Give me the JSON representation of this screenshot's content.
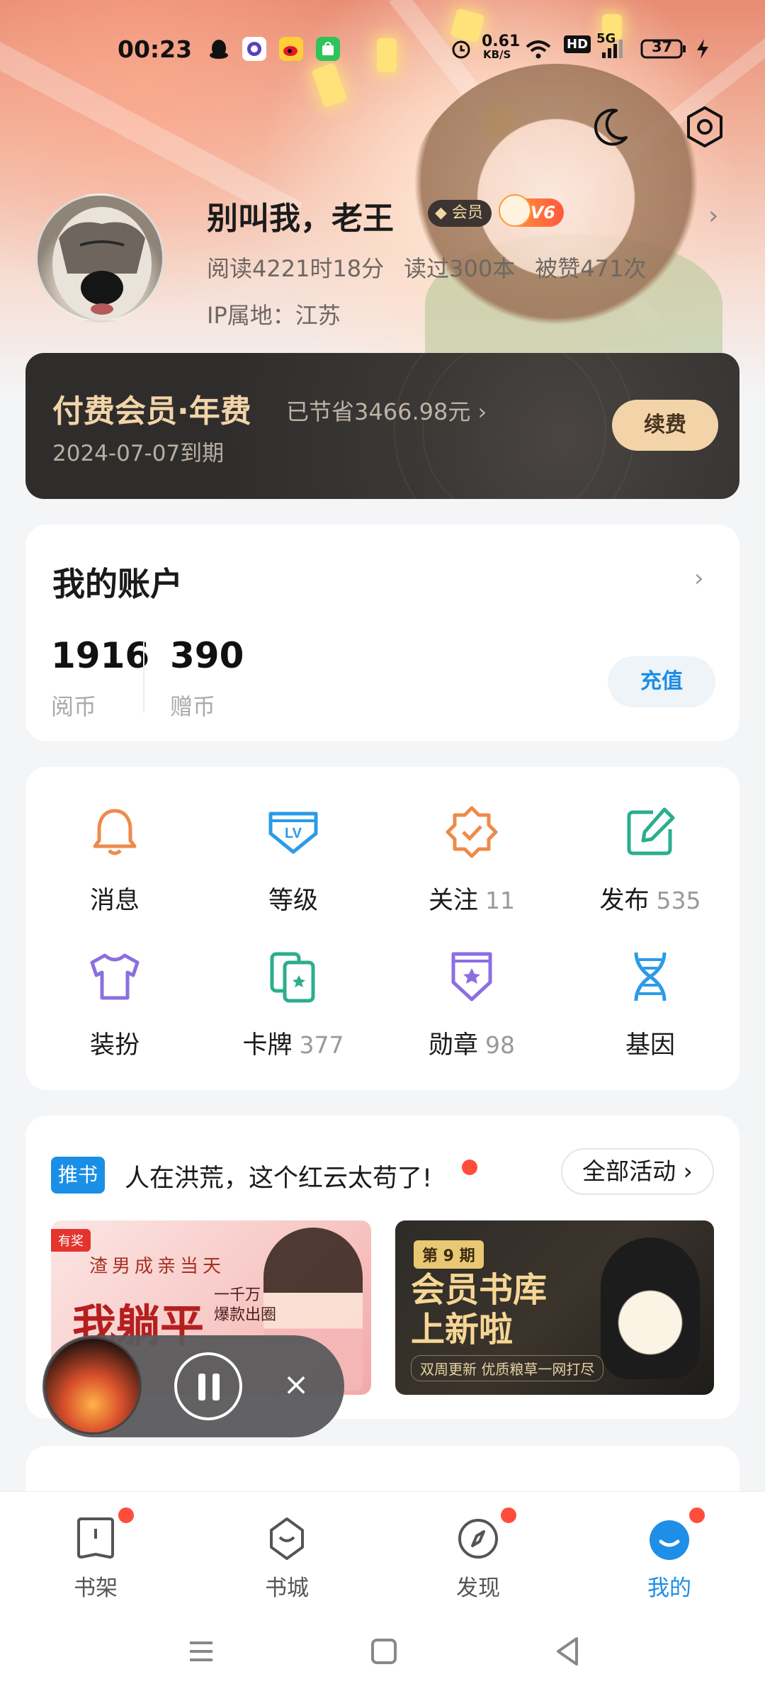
{
  "status_bar": {
    "time": "00:23",
    "net_speed_value": "0.61",
    "net_speed_unit": "KB/S",
    "hd": "HD",
    "signal": "5G",
    "battery": "37"
  },
  "profile": {
    "username": "别叫我，老王",
    "vip_badge": "会员",
    "level_badge": "V6",
    "stats": [
      "阅读4221时18分",
      "读过300本",
      "被赞471次"
    ],
    "ip_location": "IP属地：江苏"
  },
  "vip_card": {
    "title": "付费会员·年费",
    "saved": "已节省3466.98元",
    "expire": "2024-07-07到期",
    "renew_label": "续费"
  },
  "account": {
    "title": "我的账户",
    "balances": [
      {
        "value": "1916",
        "label": "阅币"
      },
      {
        "value": "390",
        "label": "赠币"
      }
    ],
    "recharge_label": "充值"
  },
  "features": [
    {
      "label": "消息",
      "count": "",
      "icon": "bell-icon",
      "color": "#ef8a4a"
    },
    {
      "label": "等级",
      "count": "",
      "icon": "level-icon",
      "color": "#2b9be8"
    },
    {
      "label": "关注",
      "count": "11",
      "icon": "follow-icon",
      "color": "#ef8a4a"
    },
    {
      "label": "发布",
      "count": "535",
      "icon": "edit-icon",
      "color": "#2bae8c"
    },
    {
      "label": "装扮",
      "count": "",
      "icon": "shirt-icon",
      "color": "#8b6fe0"
    },
    {
      "label": "卡牌",
      "count": "377",
      "icon": "cards-icon",
      "color": "#2bae8c"
    },
    {
      "label": "勋章",
      "count": "98",
      "icon": "medal-icon",
      "color": "#8b6fe0"
    },
    {
      "label": "基因",
      "count": "",
      "icon": "dna-icon",
      "color": "#2b9be8"
    }
  ],
  "promo": {
    "tag": "推书",
    "title": "人在洪荒，这个红云太苟了!",
    "all_label": "全部活动",
    "banner1": {
      "tag": "有奖",
      "line1": "渣男成亲当天",
      "line2": "我躺平",
      "line3": "一千万\n爆款出圈"
    },
    "banner2": {
      "issue": "第 9 期",
      "title": "会员书库\n上新啦",
      "subtitle": "双周更新  优质粮草一网打尽"
    }
  },
  "bottom_nav": [
    {
      "label": "书架",
      "icon": "bookshelf-icon",
      "dot": true,
      "active": false
    },
    {
      "label": "书城",
      "icon": "bookstore-icon",
      "dot": false,
      "active": false
    },
    {
      "label": "发现",
      "icon": "compass-icon",
      "dot": true,
      "active": false
    },
    {
      "label": "我的",
      "icon": "profile-icon",
      "dot": true,
      "active": true
    }
  ],
  "colors": {
    "accent": "#1e8ee6",
    "gold": "#f2d4a8",
    "red_dot": "#ff4d3c"
  }
}
